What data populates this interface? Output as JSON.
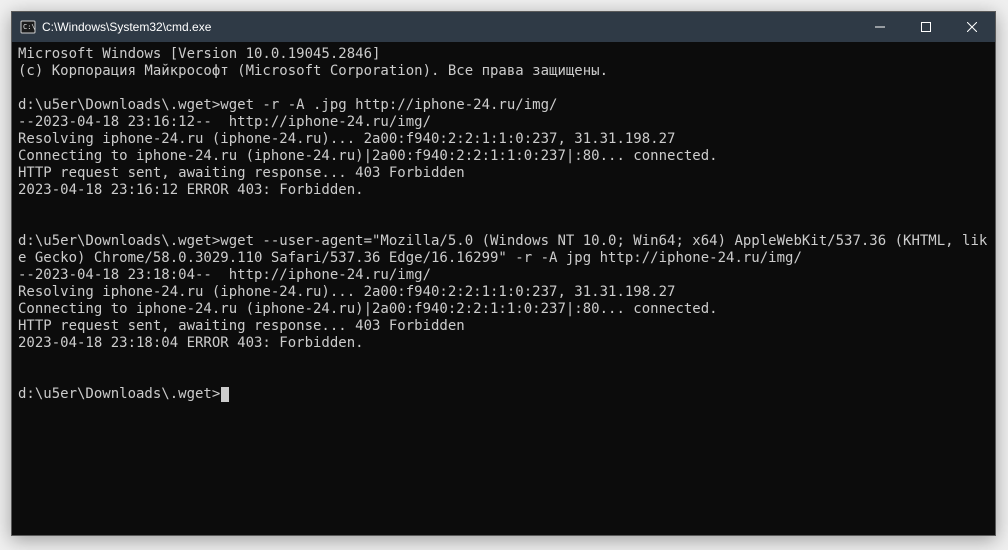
{
  "window": {
    "title": "C:\\Windows\\System32\\cmd.exe"
  },
  "terminal": {
    "lines": [
      "Microsoft Windows [Version 10.0.19045.2846]",
      "(c) Корпорация Майкрософт (Microsoft Corporation). Все права защищены.",
      "",
      "d:\\u5er\\Downloads\\.wget>wget -r -A .jpg http://iphone-24.ru/img/",
      "--2023-04-18 23:16:12--  http://iphone-24.ru/img/",
      "Resolving iphone-24.ru (iphone-24.ru)... 2a00:f940:2:2:1:1:0:237, 31.31.198.27",
      "Connecting to iphone-24.ru (iphone-24.ru)|2a00:f940:2:2:1:1:0:237|:80... connected.",
      "HTTP request sent, awaiting response... 403 Forbidden",
      "2023-04-18 23:16:12 ERROR 403: Forbidden.",
      "",
      "",
      "d:\\u5er\\Downloads\\.wget>wget --user-agent=\"Mozilla/5.0 (Windows NT 10.0; Win64; x64) AppleWebKit/537.36 (KHTML, like Gecko) Chrome/58.0.3029.110 Safari/537.36 Edge/16.16299\" -r -A jpg http://iphone-24.ru/img/",
      "--2023-04-18 23:18:04--  http://iphone-24.ru/img/",
      "Resolving iphone-24.ru (iphone-24.ru)... 2a00:f940:2:2:1:1:0:237, 31.31.198.27",
      "Connecting to iphone-24.ru (iphone-24.ru)|2a00:f940:2:2:1:1:0:237|:80... connected.",
      "HTTP request sent, awaiting response... 403 Forbidden",
      "2023-04-18 23:18:04 ERROR 403: Forbidden.",
      "",
      "",
      "d:\\u5er\\Downloads\\.wget>"
    ]
  }
}
